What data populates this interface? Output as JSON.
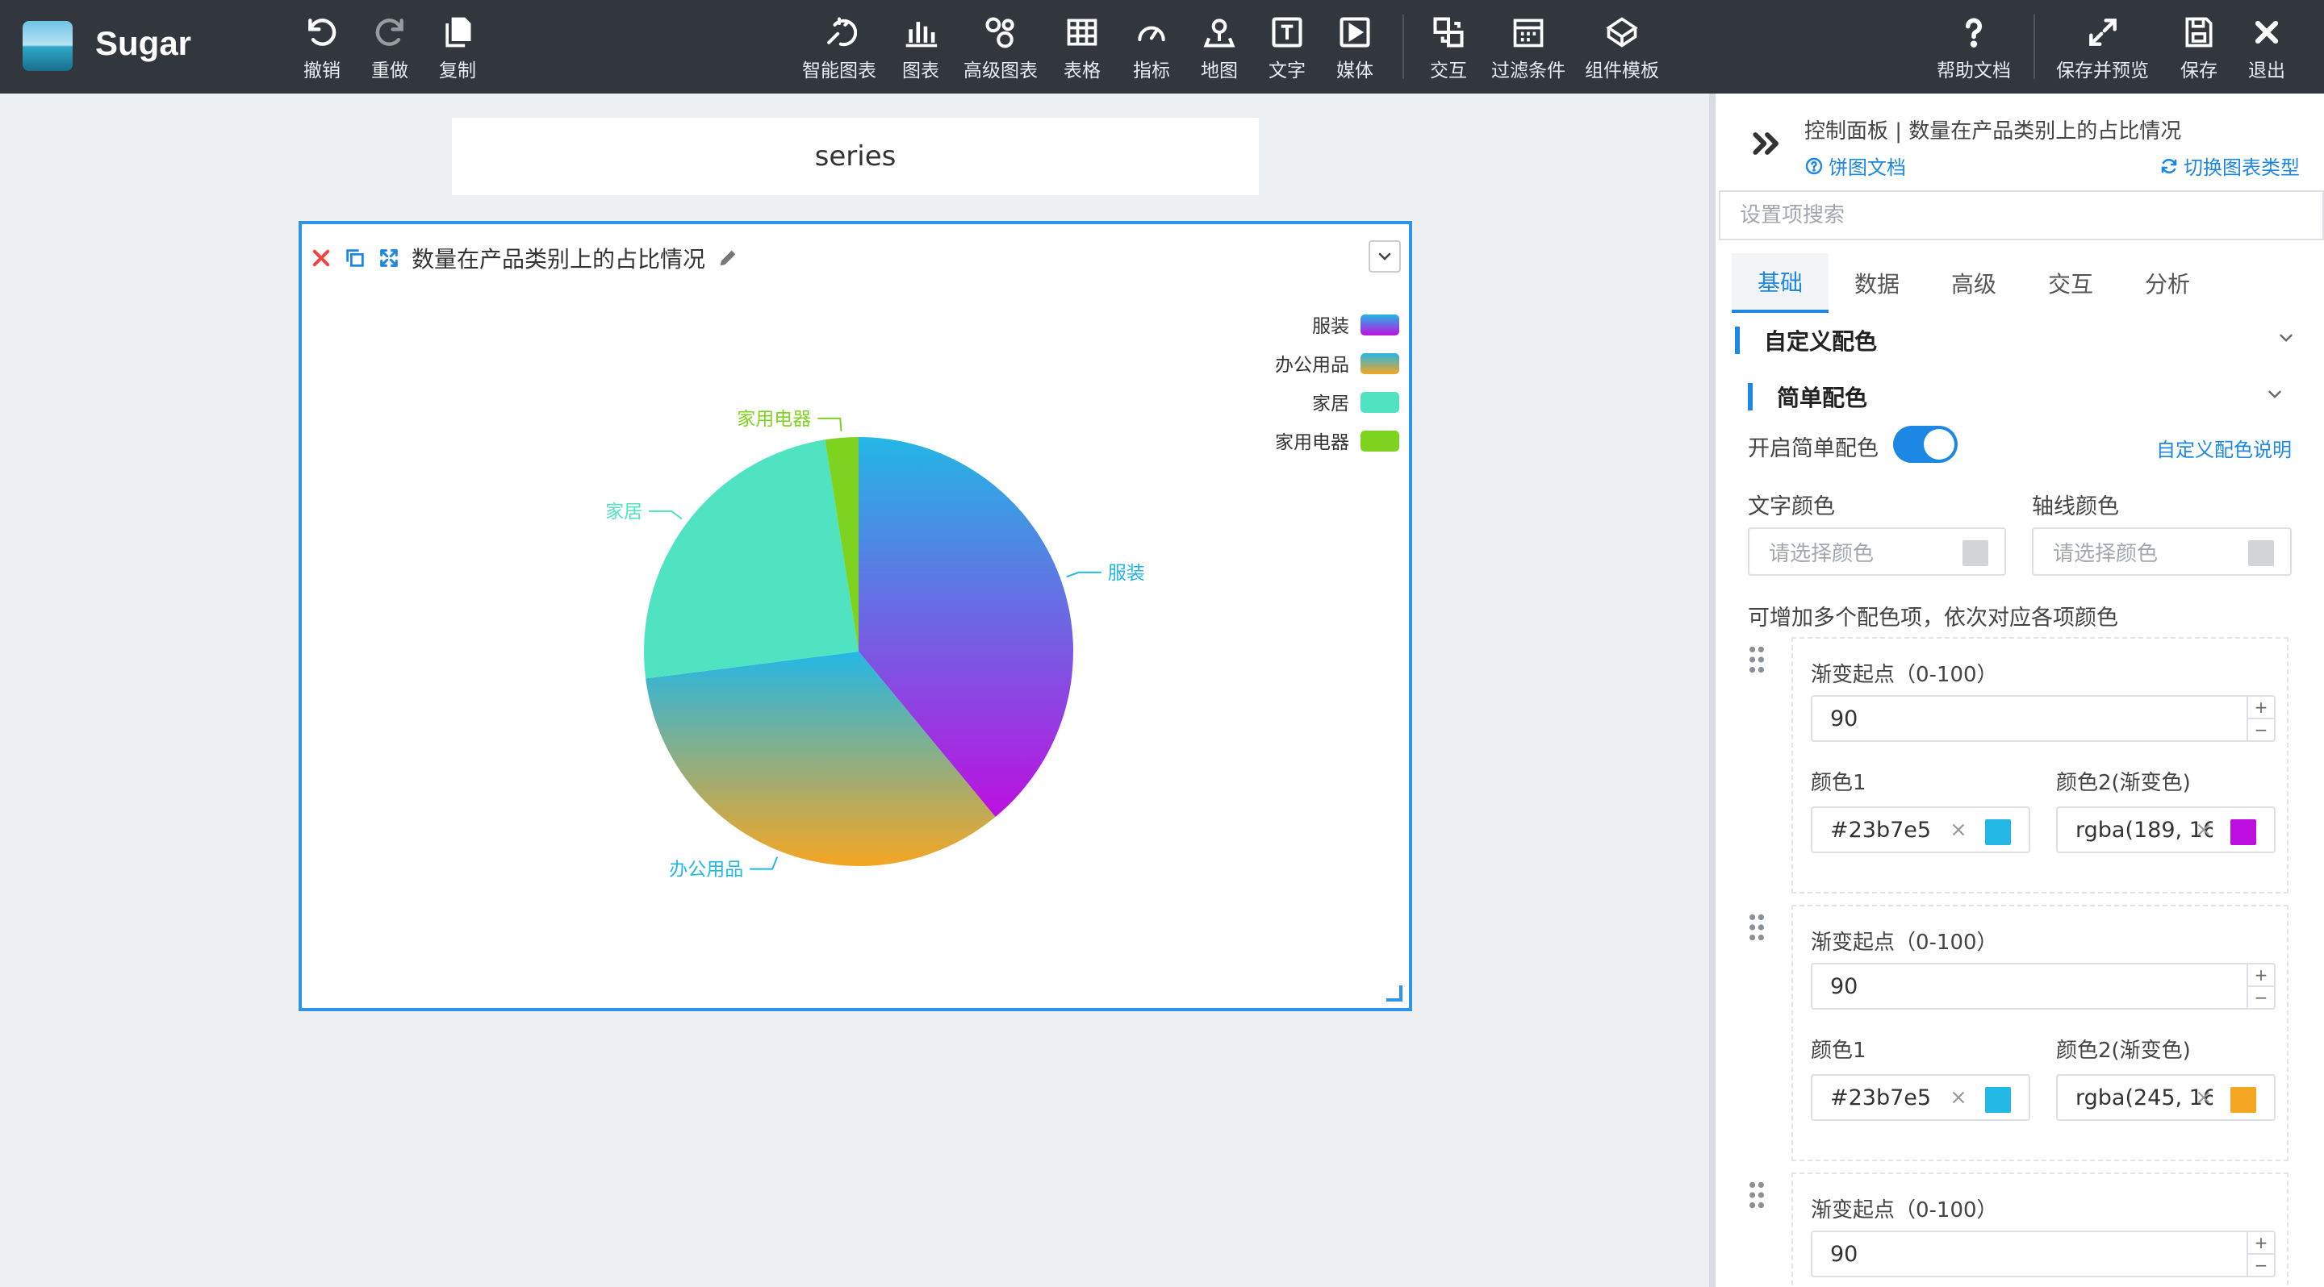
{
  "app": {
    "name": "Sugar"
  },
  "toolbar": {
    "undo": "撤销",
    "redo": "重做",
    "copy": "复制",
    "smart_chart": "智能图表",
    "chart": "图表",
    "advanced_chart": "高级图表",
    "table": "表格",
    "indicator": "指标",
    "map": "地图",
    "text": "文字",
    "media": "媒体",
    "interaction": "交互",
    "filter": "过滤条件",
    "component_template": "组件模板",
    "help": "帮助文档",
    "save_preview": "保存并预览",
    "save": "保存",
    "exit": "退出"
  },
  "canvas": {
    "series_label": "series"
  },
  "chart_card": {
    "title": "数量在产品类别上的占比情况"
  },
  "chart_data": {
    "type": "pie",
    "categories": [
      "服装",
      "办公用品",
      "家居",
      "家用电器"
    ],
    "values": [
      39,
      34,
      24.5,
      2.5
    ],
    "legend_position": "top-right",
    "gradients": [
      {
        "from": "#23b7e5",
        "to": "#bd10e0"
      },
      {
        "from": "#23b7e5",
        "to": "#f5a623"
      },
      {
        "from": "#50e3c2",
        "to": "#50e3c2"
      },
      {
        "from": "#7ed321",
        "to": "#7ed321"
      }
    ],
    "label_colors": [
      "#23b7e5",
      "#23b7e5",
      "#50e3c2",
      "#7ed321"
    ]
  },
  "panel": {
    "title": "控制面板 | 数量在产品类别上的占比情况",
    "doc_link": "饼图文档",
    "switch_link": "切换图表类型",
    "search_placeholder": "设置项搜索",
    "tabs": [
      "基础",
      "数据",
      "高级",
      "交互",
      "分析"
    ],
    "section_custom_color": "自定义配色",
    "section_simple_color": "简单配色",
    "enable_simple_color": "开启简单配色",
    "custom_color_help": "自定义配色说明",
    "text_color_label": "文字颜色",
    "axis_color_label": "轴线颜色",
    "color_placeholder": "请选择颜色",
    "add_color_hint": "可增加多个配色项，依次对应各项颜色",
    "gradient_start_label": "渐变起点（0-100）",
    "color1_label": "颜色1",
    "color2_label": "颜色2(渐变色)",
    "color_items": [
      {
        "start": "90",
        "color1": "#23b7e5",
        "color1_swatch": "#23b7e5",
        "color2": "rgba(189, 16, 224, 1)",
        "color2_swatch": "#bd10e0"
      },
      {
        "start": "90",
        "color1": "#23b7e5",
        "color1_swatch": "#23b7e5",
        "color2": "rgba(245, 166, 35, 1)",
        "color2_swatch": "#f5a623"
      },
      {
        "start": "90"
      }
    ]
  }
}
